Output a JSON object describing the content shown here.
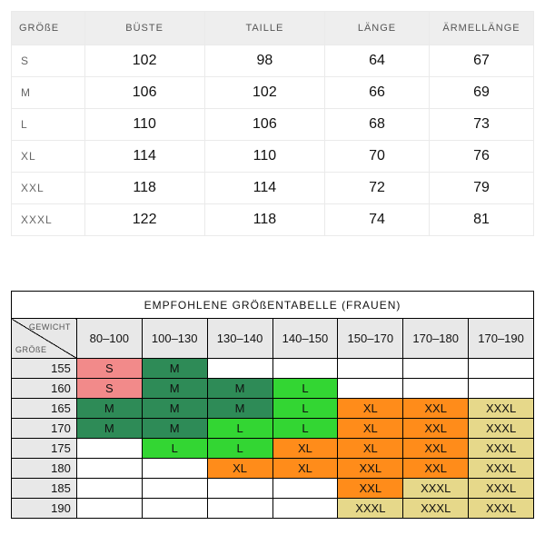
{
  "t1": {
    "headers": [
      "GRÖßE",
      "BÜSTE",
      "TAILLE",
      "LÄNGE",
      "ÄRMELLÄNGE"
    ],
    "rows": [
      {
        "size": "S",
        "bust": "102",
        "waist": "98",
        "length": "64",
        "sleeve": "67"
      },
      {
        "size": "M",
        "bust": "106",
        "waist": "102",
        "length": "66",
        "sleeve": "69"
      },
      {
        "size": "L",
        "bust": "110",
        "waist": "106",
        "length": "68",
        "sleeve": "73"
      },
      {
        "size": "XL",
        "bust": "114",
        "waist": "110",
        "length": "70",
        "sleeve": "76"
      },
      {
        "size": "XXL",
        "bust": "118",
        "waist": "114",
        "length": "72",
        "sleeve": "79"
      },
      {
        "size": "XXXL",
        "bust": "122",
        "waist": "118",
        "length": "74",
        "sleeve": "81"
      }
    ]
  },
  "t2": {
    "title": "EMPFOHLENE GRÖßENTABELLE (FRAUEN)",
    "diag_weight": "GEWICHT",
    "diag_size": "GRÖßE",
    "weights": [
      "80–100",
      "100–130",
      "130–140",
      "140–150",
      "150–170",
      "170–180",
      "170–190"
    ],
    "heights": [
      "155",
      "160",
      "165",
      "170",
      "175",
      "180",
      "185",
      "190"
    ],
    "grid": [
      [
        {
          "v": "S",
          "c": "pink"
        },
        {
          "v": "M",
          "c": "dgreen"
        },
        {
          "v": "",
          "c": ""
        },
        {
          "v": "",
          "c": ""
        },
        {
          "v": "",
          "c": ""
        },
        {
          "v": "",
          "c": ""
        },
        {
          "v": "",
          "c": ""
        }
      ],
      [
        {
          "v": "S",
          "c": "pink"
        },
        {
          "v": "M",
          "c": "dgreen"
        },
        {
          "v": "M",
          "c": "dgreen"
        },
        {
          "v": "L",
          "c": "lgreen"
        },
        {
          "v": "",
          "c": ""
        },
        {
          "v": "",
          "c": ""
        },
        {
          "v": "",
          "c": ""
        }
      ],
      [
        {
          "v": "M",
          "c": "dgreen"
        },
        {
          "v": "M",
          "c": "dgreen"
        },
        {
          "v": "M",
          "c": "dgreen"
        },
        {
          "v": "L",
          "c": "lgreen"
        },
        {
          "v": "XL",
          "c": "orange"
        },
        {
          "v": "XXL",
          "c": "orange"
        },
        {
          "v": "XXXL",
          "c": "khaki"
        }
      ],
      [
        {
          "v": "M",
          "c": "dgreen"
        },
        {
          "v": "M",
          "c": "dgreen"
        },
        {
          "v": "L",
          "c": "lgreen"
        },
        {
          "v": "L",
          "c": "lgreen"
        },
        {
          "v": "XL",
          "c": "orange"
        },
        {
          "v": "XXL",
          "c": "orange"
        },
        {
          "v": "XXXL",
          "c": "khaki"
        }
      ],
      [
        {
          "v": "",
          "c": ""
        },
        {
          "v": "L",
          "c": "lgreen"
        },
        {
          "v": "L",
          "c": "lgreen"
        },
        {
          "v": "XL",
          "c": "orange"
        },
        {
          "v": "XL",
          "c": "orange"
        },
        {
          "v": "XXL",
          "c": "orange"
        },
        {
          "v": "XXXL",
          "c": "khaki"
        }
      ],
      [
        {
          "v": "",
          "c": ""
        },
        {
          "v": "",
          "c": ""
        },
        {
          "v": "XL",
          "c": "orange"
        },
        {
          "v": "XL",
          "c": "orange"
        },
        {
          "v": "XXL",
          "c": "orange"
        },
        {
          "v": "XXL",
          "c": "orange"
        },
        {
          "v": "XXXL",
          "c": "khaki"
        }
      ],
      [
        {
          "v": "",
          "c": ""
        },
        {
          "v": "",
          "c": ""
        },
        {
          "v": "",
          "c": ""
        },
        {
          "v": "",
          "c": ""
        },
        {
          "v": "XXL",
          "c": "orange"
        },
        {
          "v": "XXXL",
          "c": "khaki"
        },
        {
          "v": "XXXL",
          "c": "khaki"
        }
      ],
      [
        {
          "v": "",
          "c": ""
        },
        {
          "v": "",
          "c": ""
        },
        {
          "v": "",
          "c": ""
        },
        {
          "v": "",
          "c": ""
        },
        {
          "v": "XXXL",
          "c": "khaki"
        },
        {
          "v": "XXXL",
          "c": "khaki"
        },
        {
          "v": "XXXL",
          "c": "khaki"
        }
      ]
    ]
  },
  "colors": {
    "pink": "#f28a8a",
    "dgreen": "#2e8b57",
    "lgreen": "#33d633",
    "orange": "#ff8c1a",
    "khaki": "#e6d88a"
  },
  "chart_data": [
    {
      "type": "table",
      "title": "Measurements by size (cm)",
      "columns": [
        "GRÖßE",
        "BÜSTE",
        "TAILLE",
        "LÄNGE",
        "ÄRMELLÄNGE"
      ],
      "rows": [
        [
          "S",
          102,
          98,
          64,
          67
        ],
        [
          "M",
          106,
          102,
          66,
          69
        ],
        [
          "L",
          110,
          106,
          68,
          73
        ],
        [
          "XL",
          114,
          110,
          70,
          76
        ],
        [
          "XXL",
          118,
          114,
          72,
          79
        ],
        [
          "XXXL",
          122,
          118,
          74,
          81
        ]
      ]
    },
    {
      "type": "heatmap",
      "title": "EMPFOHLENE GRÖßENTABELLE (FRAUEN)",
      "xlabel": "GEWICHT",
      "ylabel": "GRÖßE",
      "x": [
        "80–100",
        "100–130",
        "130–140",
        "140–150",
        "150–170",
        "170–180",
        "170–190"
      ],
      "y": [
        "155",
        "160",
        "165",
        "170",
        "175",
        "180",
        "185",
        "190"
      ],
      "values": [
        [
          "S",
          "M",
          "",
          "",
          "",
          "",
          ""
        ],
        [
          "S",
          "M",
          "M",
          "L",
          "",
          "",
          ""
        ],
        [
          "M",
          "M",
          "M",
          "L",
          "XL",
          "XXL",
          "XXXL"
        ],
        [
          "M",
          "M",
          "L",
          "L",
          "XL",
          "XXL",
          "XXXL"
        ],
        [
          "",
          "L",
          "L",
          "XL",
          "XL",
          "XXL",
          "XXXL"
        ],
        [
          "",
          "",
          "XL",
          "XL",
          "XXL",
          "XXL",
          "XXXL"
        ],
        [
          "",
          "",
          "",
          "",
          "XXL",
          "XXXL",
          "XXXL"
        ],
        [
          "",
          "",
          "",
          "",
          "XXXL",
          "XXXL",
          "XXXL"
        ]
      ],
      "color_map": {
        "S": "pink",
        "M": "dgreen",
        "L": "lgreen",
        "XL": "orange",
        "XXL": "orange",
        "XXXL": "khaki"
      }
    }
  ]
}
